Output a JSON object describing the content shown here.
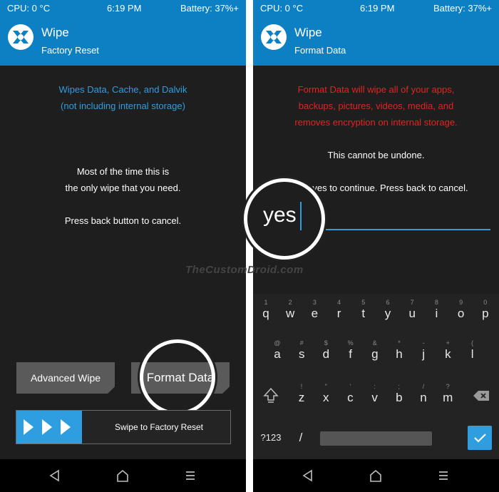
{
  "left": {
    "status": {
      "cpu": "CPU: 0 °C",
      "time": "6:19 PM",
      "battery": "Battery: 37%+"
    },
    "title": "Wipe",
    "subtitle": "Factory Reset",
    "info_line1": "Wipes Data, Cache, and Dalvik",
    "info_line2": "(not including internal storage)",
    "body_line1": "Most of the time this is",
    "body_line2": "the only wipe that you need.",
    "body_line3": "Press back button to cancel.",
    "advanced_wipe": "Advanced Wipe",
    "format_data": "Format Data",
    "swipe_label": "Swipe to Factory Reset"
  },
  "right": {
    "status": {
      "cpu": "CPU: 0 °C",
      "time": "6:19 PM",
      "battery": "Battery: 37%+"
    },
    "title": "Wipe",
    "subtitle": "Format Data",
    "warn_line1": "Format Data will wipe all of your apps,",
    "warn_line2": "backups, pictures, videos, media, and",
    "warn_line3": "removes encryption on internal storage.",
    "undone": "This cannot be undone.",
    "prompt": "yes to continue.  Press back to cancel.",
    "input_value": "yes",
    "keyboard": {
      "row1": [
        {
          "k": "q",
          "s": "1"
        },
        {
          "k": "w",
          "s": "2"
        },
        {
          "k": "e",
          "s": "3"
        },
        {
          "k": "r",
          "s": "4"
        },
        {
          "k": "t",
          "s": "5"
        },
        {
          "k": "y",
          "s": "6"
        },
        {
          "k": "u",
          "s": "7"
        },
        {
          "k": "i",
          "s": "8"
        },
        {
          "k": "o",
          "s": "9"
        },
        {
          "k": "p",
          "s": "0"
        }
      ],
      "row2": [
        {
          "k": "a",
          "s": "@"
        },
        {
          "k": "s",
          "s": "#"
        },
        {
          "k": "d",
          "s": "$"
        },
        {
          "k": "f",
          "s": "%"
        },
        {
          "k": "g",
          "s": "&"
        },
        {
          "k": "h",
          "s": "*"
        },
        {
          "k": "j",
          "s": "-"
        },
        {
          "k": "k",
          "s": "+"
        },
        {
          "k": "l",
          "s": "("
        }
      ],
      "row3": [
        {
          "k": "z",
          "s": "!"
        },
        {
          "k": "x",
          "s": "\""
        },
        {
          "k": "c",
          "s": "'"
        },
        {
          "k": "v",
          "s": ":"
        },
        {
          "k": "b",
          "s": ";"
        },
        {
          "k": "n",
          "s": "/"
        },
        {
          "k": "m",
          "s": "?"
        }
      ],
      "sym_label": "?123",
      "slash_key": "/"
    }
  },
  "watermark": "TheCustomDroid.com",
  "colors": {
    "accent": "#0d80c4",
    "handle": "#2f9ee0",
    "warn": "#e62222",
    "bg": "#1e1e1e"
  }
}
